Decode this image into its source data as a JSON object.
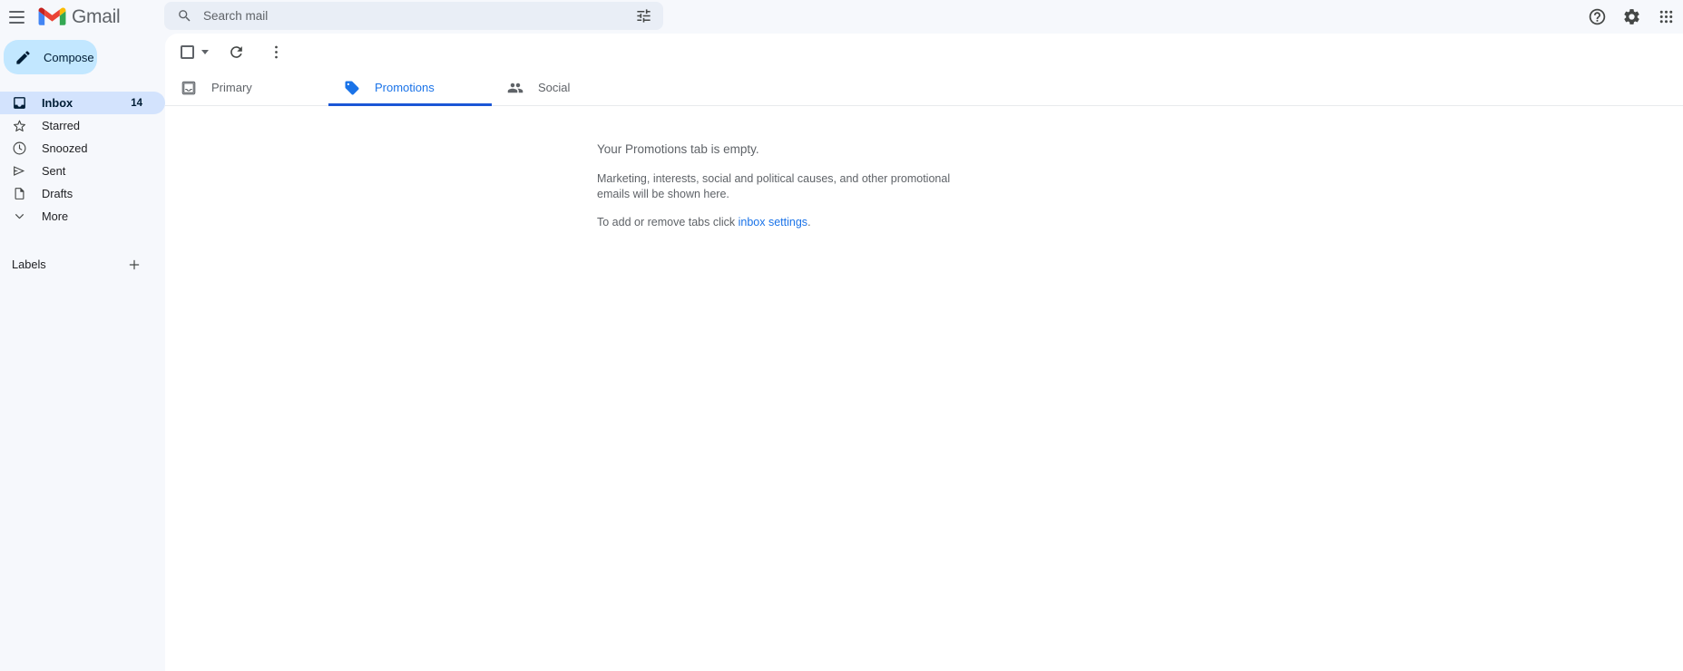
{
  "topbar": {
    "menu_icon": "hamburger-menu-icon",
    "logo_icon": "gmail-logo-icon",
    "brand_name": "Gmail",
    "search": {
      "icon": "search-icon",
      "placeholder": "Search mail",
      "value": "",
      "options_icon": "tune-filter-icon"
    },
    "help_icon": "help-circle-icon",
    "settings_icon": "gear-icon",
    "apps_icon": "apps-grid-icon"
  },
  "sidebar": {
    "compose": {
      "label": "Compose",
      "icon": "pencil-icon"
    },
    "items": [
      {
        "label": "Inbox",
        "icon": "inbox-icon",
        "count": "14",
        "active": true
      },
      {
        "label": "Starred",
        "icon": "star-icon",
        "count": "",
        "active": false
      },
      {
        "label": "Snoozed",
        "icon": "clock-icon",
        "count": "",
        "active": false
      },
      {
        "label": "Sent",
        "icon": "send-icon",
        "count": "",
        "active": false
      },
      {
        "label": "Drafts",
        "icon": "draft-icon",
        "count": "",
        "active": false
      },
      {
        "label": "More",
        "icon": "chevron-down-icon",
        "count": "",
        "active": false
      }
    ],
    "labels": {
      "title": "Labels",
      "add_icon": "plus-icon"
    }
  },
  "main": {
    "toolbar": {
      "select_all_icon": "checkbox-icon",
      "select_all_caret_icon": "chevron-down-icon",
      "refresh_icon": "refresh-icon",
      "more_icon": "more-vertical-icon"
    },
    "tabs": [
      {
        "label": "Primary",
        "icon": "inbox-icon",
        "active": false
      },
      {
        "label": "Promotions",
        "icon": "tag-icon",
        "active": true
      },
      {
        "label": "Social",
        "icon": "people-icon",
        "active": false
      }
    ],
    "empty_state": {
      "title": "Your Promotions tab is empty.",
      "body": "Marketing, interests, social and political causes, and other promotional emails will be shown here.",
      "cta_prefix": "To add or remove tabs click ",
      "cta_link": "inbox settings",
      "cta_suffix": "."
    }
  },
  "colors": {
    "accent_blue": "#1a73e8",
    "tab_underline": "#1a56d6",
    "compose_bg": "#c2e7ff",
    "active_nav_bg": "#d3e3fd",
    "sidebar_bg": "#f6f8fc",
    "search_bg": "#e9eef6",
    "panel_bg": "#ffffff",
    "text_secondary": "#5f6368"
  }
}
